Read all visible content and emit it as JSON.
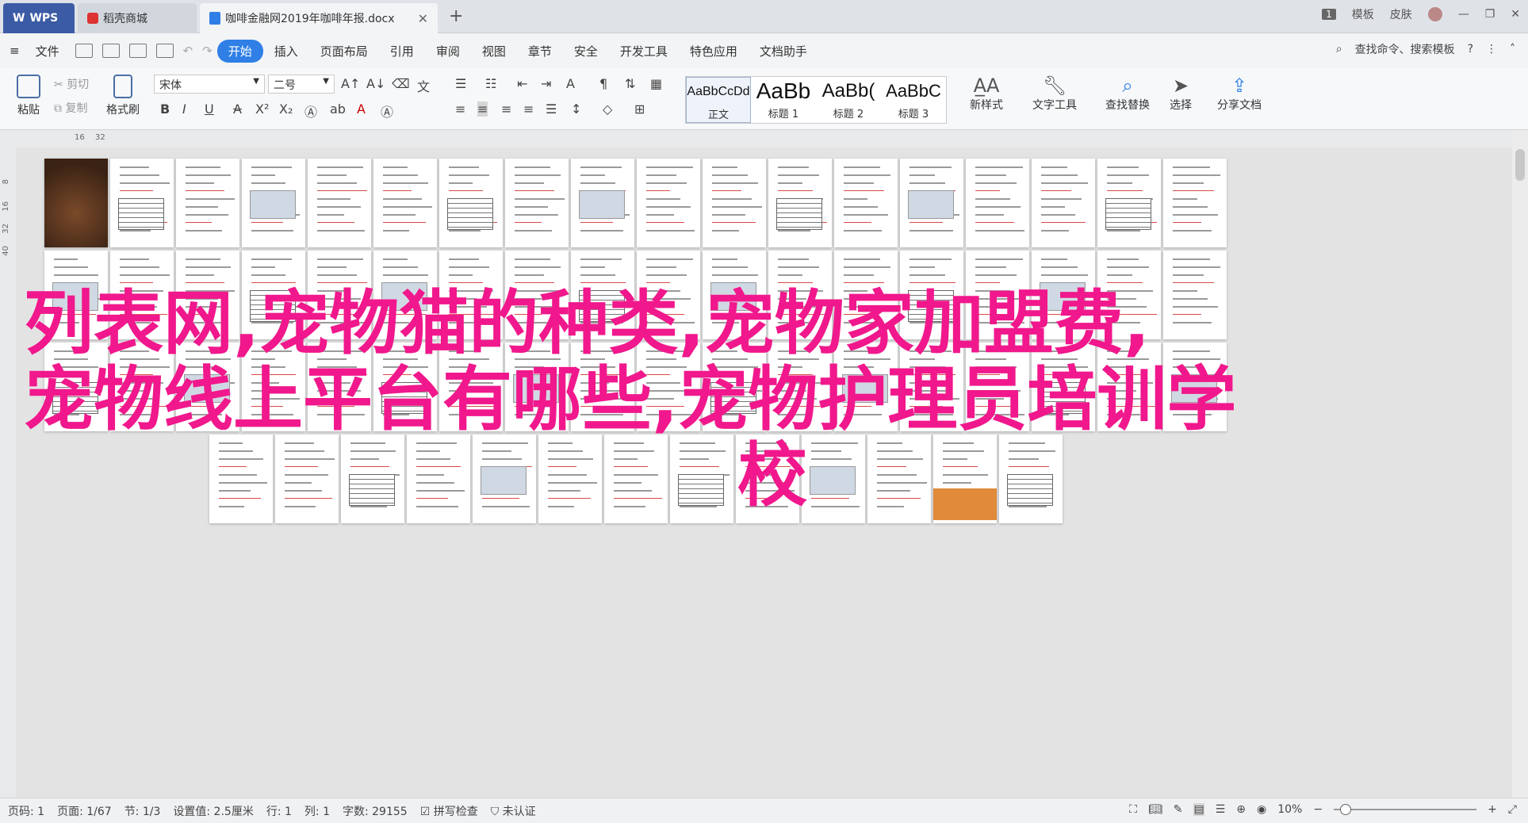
{
  "tabs": {
    "wps_label": "WPS",
    "shop_label": "稻壳商城",
    "doc_label": "咖啡金融网2019年咖啡年报.docx",
    "new_tab": "+",
    "close": "✕"
  },
  "topbar": {
    "badge": "1",
    "template": "模板",
    "skin": "皮肤"
  },
  "menu": {
    "file": "文件",
    "items": [
      "开始",
      "插入",
      "页面布局",
      "引用",
      "审阅",
      "视图",
      "章节",
      "安全",
      "开发工具",
      "特色应用",
      "文档助手"
    ],
    "search": "查找命令、搜索模板"
  },
  "ribbon": {
    "paste": "粘贴",
    "cut": "剪切",
    "copy": "复制",
    "format_painter": "格式刷",
    "font_name": "宋体",
    "font_size": "二号",
    "styles": [
      {
        "sample": "AaBbCcDd",
        "name": "正文"
      },
      {
        "sample": "AaBb",
        "name": "标题 1"
      },
      {
        "sample": "AaBb(",
        "name": "标题 2"
      },
      {
        "sample": "AaBbC",
        "name": "标题 3"
      }
    ],
    "new_style": "新样式",
    "text_tools": "文字工具",
    "find_replace": "查找替换",
    "select": "选择",
    "share": "分享文档"
  },
  "ruler": {
    "h_ticks": [
      "16",
      "32"
    ],
    "v_ticks": [
      "8",
      "16",
      "32",
      "40"
    ]
  },
  "watermark": {
    "line1": "列表网,宠物猫的种类,宠物家加盟费,",
    "line2": "宠物线上平台有哪些,宠物护理员培训学",
    "line3": "校"
  },
  "status": {
    "page_num": "页码: 1",
    "page_total": "页面: 1/67",
    "section": "节: 1/3",
    "setting": "设置值: 2.5厘米",
    "row": "行: 1",
    "col": "列: 1",
    "word_count": "字数: 29155",
    "spell_check": "拼写检查",
    "cert": "未认证",
    "zoom": "10%",
    "zoom_fraction": 0.05
  },
  "colors": {
    "accent": "#2f7fe6",
    "watermark": "#f0188c",
    "wps_tab": "#3b5ba5"
  }
}
